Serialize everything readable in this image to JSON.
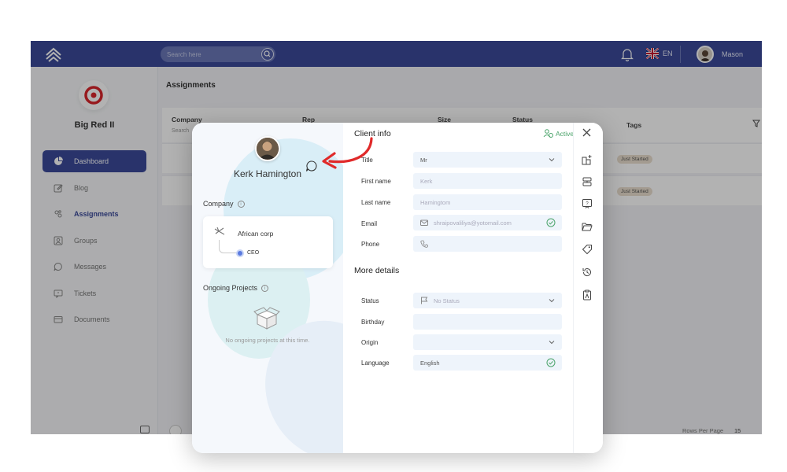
{
  "topbar": {
    "search_placeholder": "Search here",
    "language": "EN",
    "user_name": "Mason"
  },
  "sidebar": {
    "brand": "Big Red II",
    "items": [
      {
        "label": "Dashboard",
        "icon": "pie-chart-icon"
      },
      {
        "label": "Blog",
        "icon": "edit-icon"
      },
      {
        "label": "Assignments",
        "icon": "assignments-icon"
      },
      {
        "label": "Groups",
        "icon": "groups-icon"
      },
      {
        "label": "Messages",
        "icon": "message-icon"
      },
      {
        "label": "Tickets",
        "icon": "ticket-icon"
      },
      {
        "label": "Documents",
        "icon": "folder-icon"
      }
    ]
  },
  "page": {
    "title": "Assignments",
    "columns": {
      "company": "Company",
      "rep": "Rep",
      "size": "Size",
      "status": "Status",
      "tags": "Tags"
    },
    "search_hint": "Search",
    "rows": [
      {
        "tag": "Just Started"
      },
      {
        "tag": "Just Started"
      }
    ],
    "rows_per_page_label": "Rows Per Page",
    "rows_per_page_value": "15"
  },
  "client": {
    "name": "Kerk Hamington",
    "company_section": "Company",
    "company_name": "African corp",
    "role": "CEO",
    "projects_section": "Ongoing Projects",
    "no_projects": "No ongoing projects at this time."
  },
  "client_info": {
    "title": "Client info",
    "status_label": "Active",
    "fields": {
      "title_label": "Title",
      "title_value": "Mr",
      "first_label": "First name",
      "first_value": "Kerk",
      "last_label": "Last name",
      "last_value": "Hamingtom",
      "email_label": "Email",
      "email_value": "shraipovaliliya@yotomail.com",
      "phone_label": "Phone"
    },
    "more_details": "More details",
    "details": {
      "status_label": "Status",
      "status_value": "No Status",
      "birthday_label": "Birthday",
      "origin_label": "Origin",
      "language_label": "Language",
      "language_value": "English"
    }
  },
  "colors": {
    "primary": "#3b4a9a",
    "active_green": "#4aa36a",
    "annotation_red": "#e02a2a"
  }
}
